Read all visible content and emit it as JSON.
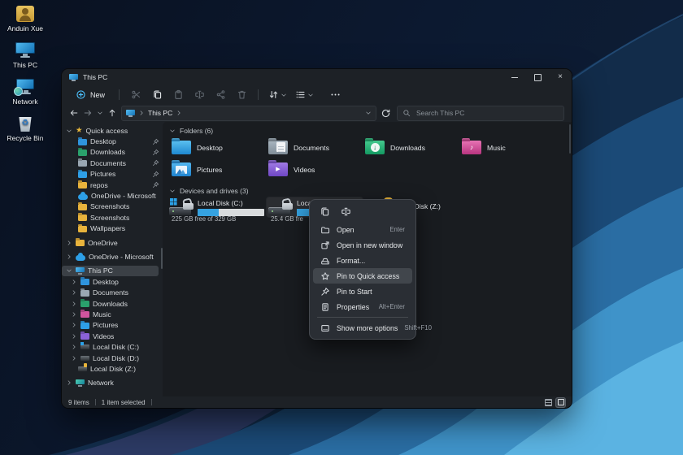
{
  "colors": {
    "accent_blue": "#35a2e0",
    "bar_track": "#d8dbdd",
    "lock_gold": "#e7b33a"
  },
  "desktop": {
    "icons": [
      {
        "label": "Anduin Xue"
      },
      {
        "label": "This PC"
      },
      {
        "label": "Network"
      },
      {
        "label": "Recycle Bin"
      }
    ]
  },
  "window": {
    "title": "This PC",
    "toolbar": {
      "new_label": "New"
    },
    "addressbar": {
      "root": "This PC",
      "search_placeholder": "Search This PC"
    },
    "sidebar": {
      "items": [
        {
          "label": "Quick access"
        },
        {
          "label": "Desktop"
        },
        {
          "label": "Downloads"
        },
        {
          "label": "Documents"
        },
        {
          "label": "Pictures"
        },
        {
          "label": "repos"
        },
        {
          "label": "OneDrive - Microsoft"
        },
        {
          "label": "Screenshots"
        },
        {
          "label": "Screenshots"
        },
        {
          "label": "Wallpapers"
        },
        {
          "label": "OneDrive"
        },
        {
          "label": "OneDrive - Microsoft"
        },
        {
          "label": "This PC"
        },
        {
          "label": "Desktop"
        },
        {
          "label": "Documents"
        },
        {
          "label": "Downloads"
        },
        {
          "label": "Music"
        },
        {
          "label": "Pictures"
        },
        {
          "label": "Videos"
        },
        {
          "label": "Local Disk (C:)"
        },
        {
          "label": "Local Disk (D:)"
        },
        {
          "label": "Local Disk (Z:)"
        },
        {
          "label": "Network"
        }
      ]
    },
    "content": {
      "folders_header": "Folders (6)",
      "folders": [
        {
          "label": "Desktop"
        },
        {
          "label": "Documents"
        },
        {
          "label": "Downloads"
        },
        {
          "label": "Music"
        },
        {
          "label": "Pictures"
        },
        {
          "label": "Videos"
        }
      ],
      "drives_header": "Devices and drives (3)",
      "drives": [
        {
          "label": "Local Disk (C:)",
          "free_text": "225 GB free of 329 GB",
          "used_pct": 32
        },
        {
          "label": "Local Disk (D:)",
          "free_text": "25.4 GB fre",
          "used_pct": 78
        },
        {
          "label": "Local Disk (Z:)"
        }
      ]
    },
    "statusbar": {
      "count": "9 items",
      "selected": "1 item selected"
    }
  },
  "context_menu": {
    "items": [
      {
        "label": "Open",
        "shortcut": "Enter"
      },
      {
        "label": "Open in new window",
        "shortcut": ""
      },
      {
        "label": "Format...",
        "shortcut": ""
      },
      {
        "label": "Pin to Quick access",
        "shortcut": ""
      },
      {
        "label": "Pin to Start",
        "shortcut": ""
      },
      {
        "label": "Properties",
        "shortcut": "Alt+Enter"
      },
      {
        "label": "Show more options",
        "shortcut": "Shift+F10"
      }
    ]
  }
}
